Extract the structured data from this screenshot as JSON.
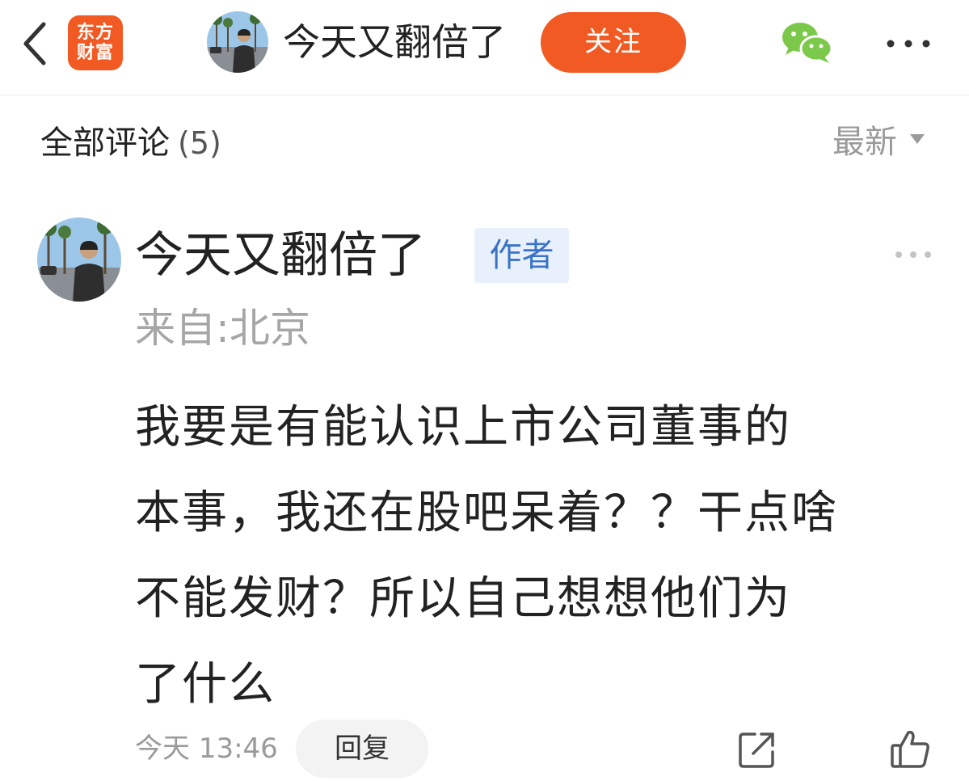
{
  "header": {
    "app_logo_line1": "东方",
    "app_logo_line2": "财富",
    "user_name": "今天又翻倍了",
    "follow_label": "关注"
  },
  "comments_section": {
    "title": "全部评论",
    "count": "(5)",
    "sort_label": "最新"
  },
  "comment": {
    "author": "今天又翻倍了",
    "badge": "作者",
    "location": "来自:北京",
    "body_lines": [
      "我要是有能认识上市公司董事的",
      "本事，我还在股吧呆着？？干点啥",
      "不能发财？所以自己想想他们为",
      "了什么"
    ],
    "time": "今天 13:46",
    "reply_label": "回复"
  },
  "icons": {
    "back": "chevron-left-icon",
    "share_wechat": "wechat-icon",
    "more": "more-horizontal-icon",
    "share": "share-icon",
    "like": "thumbs-up-icon"
  },
  "colors": {
    "accent": "#f25a23",
    "badge_bg": "#e8f0fb",
    "badge_text": "#3a73c8",
    "wechat_green": "#7bc84a",
    "muted_text": "#9a9a9a"
  }
}
